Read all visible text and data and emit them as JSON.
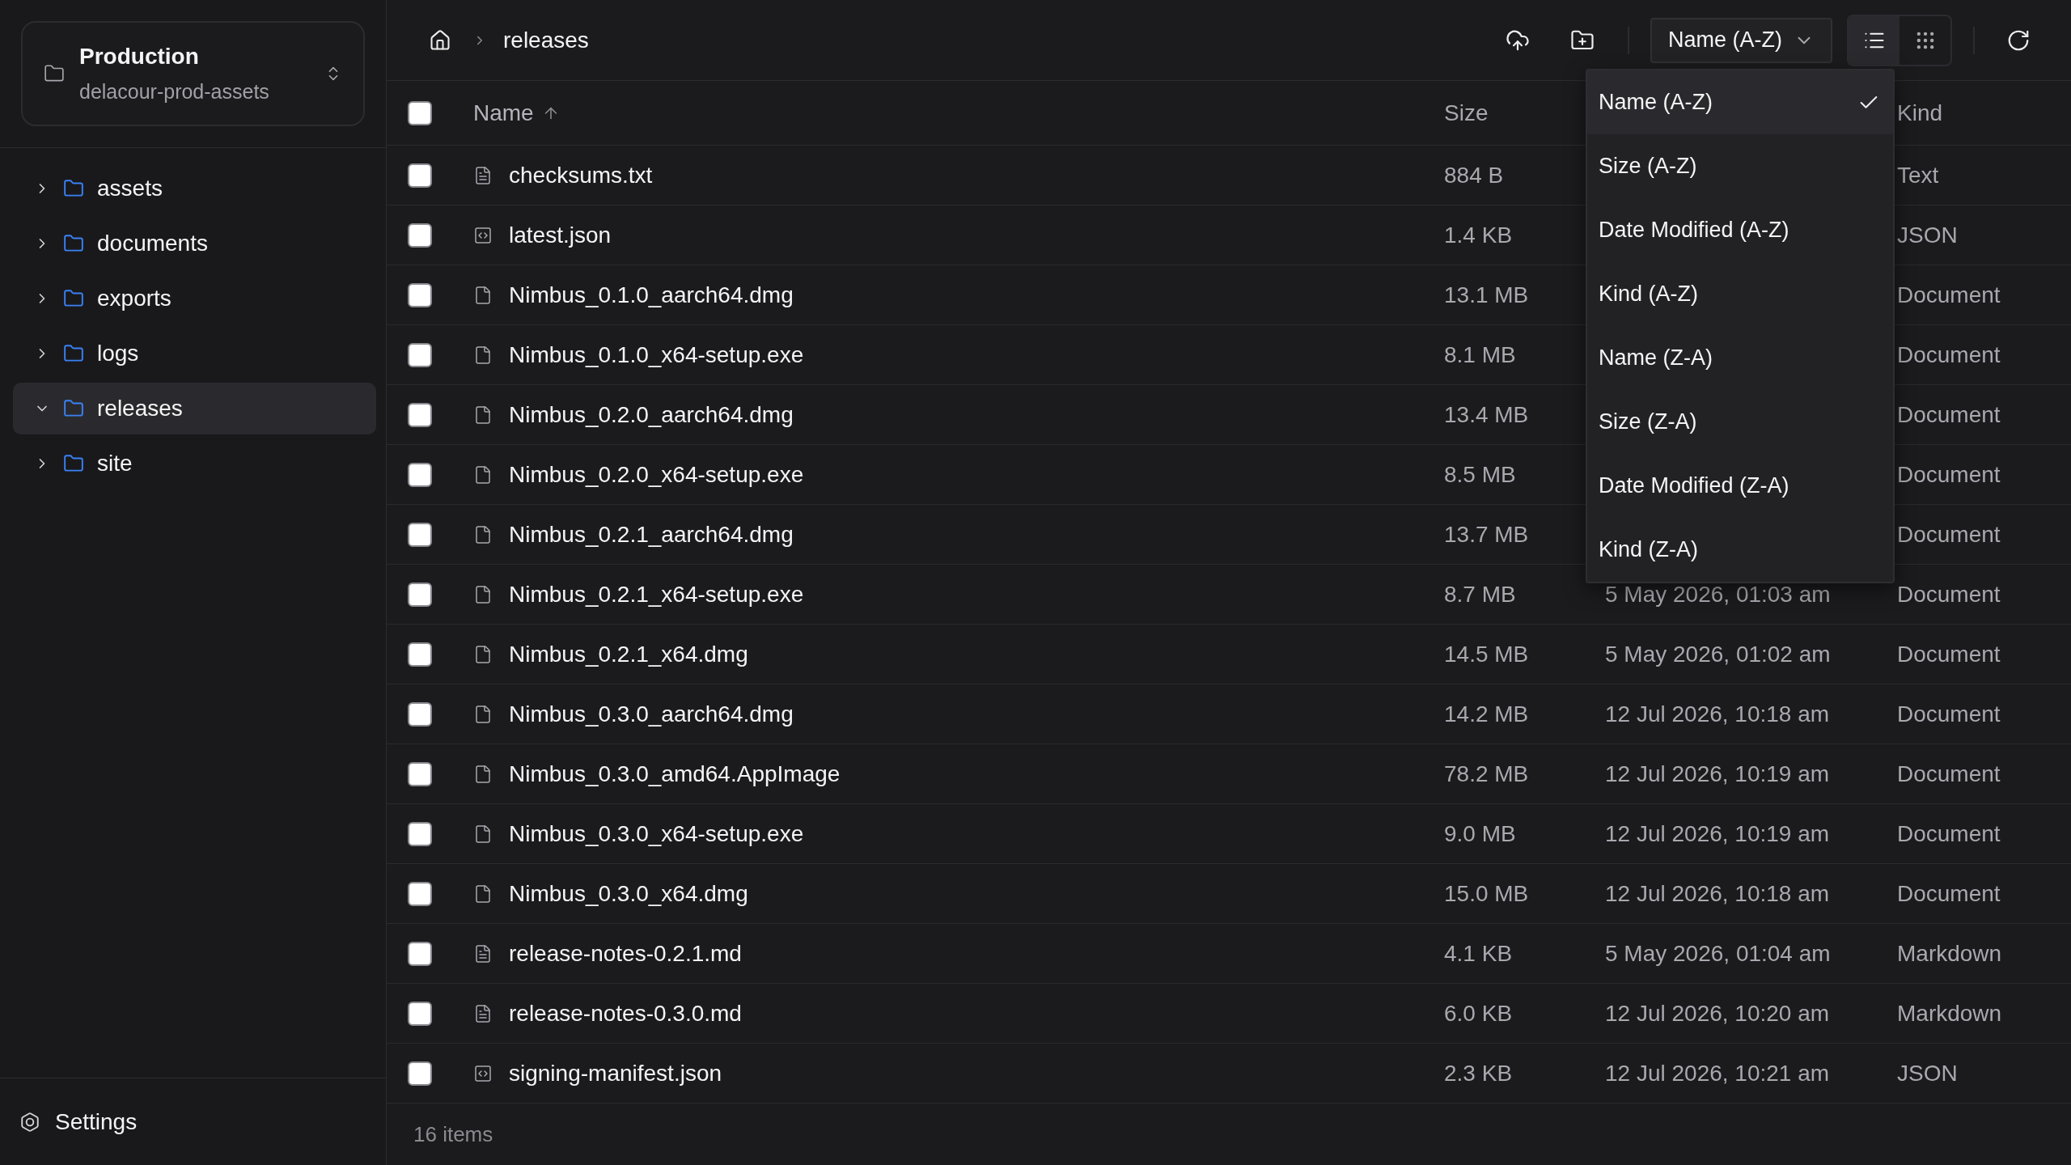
{
  "sidebar": {
    "workspace": {
      "title": "Production",
      "subtitle": "delacour-prod-assets"
    },
    "tree": [
      {
        "label": "assets",
        "expanded": false,
        "selected": false
      },
      {
        "label": "documents",
        "expanded": false,
        "selected": false
      },
      {
        "label": "exports",
        "expanded": false,
        "selected": false
      },
      {
        "label": "logs",
        "expanded": false,
        "selected": false
      },
      {
        "label": "releases",
        "expanded": true,
        "selected": true
      },
      {
        "label": "site",
        "expanded": false,
        "selected": false
      }
    ],
    "settings": {
      "label": "Settings"
    }
  },
  "toolbar": {
    "breadcrumb": [
      "releases"
    ],
    "sort": {
      "label": "Name (A-Z)",
      "open": true,
      "menu": [
        {
          "label": "Name (A-Z)",
          "selected": true
        },
        {
          "label": "Size (A-Z)",
          "selected": false
        },
        {
          "label": "Date Modified (A-Z)",
          "selected": false
        },
        {
          "label": "Kind (A-Z)",
          "selected": false
        },
        {
          "label": "Name (Z-A)",
          "selected": false
        },
        {
          "label": "Size (Z-A)",
          "selected": false
        },
        {
          "label": "Date Modified (Z-A)",
          "selected": false
        },
        {
          "label": "Kind (Z-A)",
          "selected": false
        }
      ]
    },
    "view_modes": [
      {
        "kind": "list",
        "selected": true
      },
      {
        "kind": "grid",
        "selected": false
      }
    ]
  },
  "table": {
    "select_all": {
      "checked": false
    },
    "columns": [
      {
        "kind": "name",
        "label": "Name",
        "sorted": true
      },
      {
        "kind": "size",
        "label": "Size",
        "sorted": false
      },
      {
        "kind": "type",
        "label": "Kind",
        "sorted": false
      }
    ],
    "rows": [
      {
        "name": "checksums.txt",
        "kind": "text",
        "size": "884 B",
        "file_kind": "Text",
        "checked": false
      },
      {
        "name": "latest.json",
        "kind": "code",
        "size": "1.4 KB",
        "file_kind": "JSON",
        "checked": false
      },
      {
        "name": "Nimbus_0.1.0_aarch64.dmg",
        "kind": "file",
        "size": "13.1 MB",
        "file_kind": "Document",
        "checked": false
      },
      {
        "name": "Nimbus_0.1.0_x64-setup.exe",
        "kind": "file",
        "size": "8.1 MB",
        "file_kind": "Document",
        "checked": false
      },
      {
        "name": "Nimbus_0.2.0_aarch64.dmg",
        "kind": "file",
        "size": "13.4 MB",
        "file_kind": "Document",
        "checked": false
      },
      {
        "name": "Nimbus_0.2.0_x64-setup.exe",
        "kind": "file",
        "size": "8.5 MB",
        "file_kind": "Document",
        "checked": false
      },
      {
        "name": "Nimbus_0.2.1_aarch64.dmg",
        "kind": "file",
        "size": "13.7 MB",
        "file_kind": "Document",
        "checked": false
      },
      {
        "name": "Nimbus_0.2.1_x64-setup.exe",
        "kind": "file",
        "size": "8.7 MB",
        "modified": "5 May 2026, 01:03 am",
        "file_kind": "Document",
        "checked": false
      },
      {
        "name": "Nimbus_0.2.1_x64.dmg",
        "kind": "file",
        "size": "14.5 MB",
        "modified": "5 May 2026, 01:02 am",
        "file_kind": "Document",
        "checked": false
      },
      {
        "name": "Nimbus_0.3.0_aarch64.dmg",
        "kind": "file",
        "size": "14.2 MB",
        "modified": "12 Jul 2026, 10:18 am",
        "file_kind": "Document",
        "checked": false
      },
      {
        "name": "Nimbus_0.3.0_amd64.AppImage",
        "kind": "file",
        "size": "78.2 MB",
        "modified": "12 Jul 2026, 10:19 am",
        "file_kind": "Document",
        "checked": false
      },
      {
        "name": "Nimbus_0.3.0_x64-setup.exe",
        "kind": "file",
        "size": "9.0 MB",
        "modified": "12 Jul 2026, 10:19 am",
        "file_kind": "Document",
        "checked": false
      },
      {
        "name": "Nimbus_0.3.0_x64.dmg",
        "kind": "file",
        "size": "15.0 MB",
        "modified": "12 Jul 2026, 10:18 am",
        "file_kind": "Document",
        "checked": false
      },
      {
        "name": "release-notes-0.2.1.md",
        "kind": "text",
        "size": "4.1 KB",
        "modified": "5 May 2026, 01:04 am",
        "file_kind": "Markdown",
        "checked": false
      },
      {
        "name": "release-notes-0.3.0.md",
        "kind": "text",
        "size": "6.0 KB",
        "modified": "12 Jul 2026, 10:20 am",
        "file_kind": "Markdown",
        "checked": false
      },
      {
        "name": "signing-manifest.json",
        "kind": "code",
        "size": "2.3 KB",
        "modified": "12 Jul 2026, 10:21 am",
        "file_kind": "JSON",
        "checked": false
      }
    ]
  },
  "status_bar": {
    "count": "16 items"
  }
}
